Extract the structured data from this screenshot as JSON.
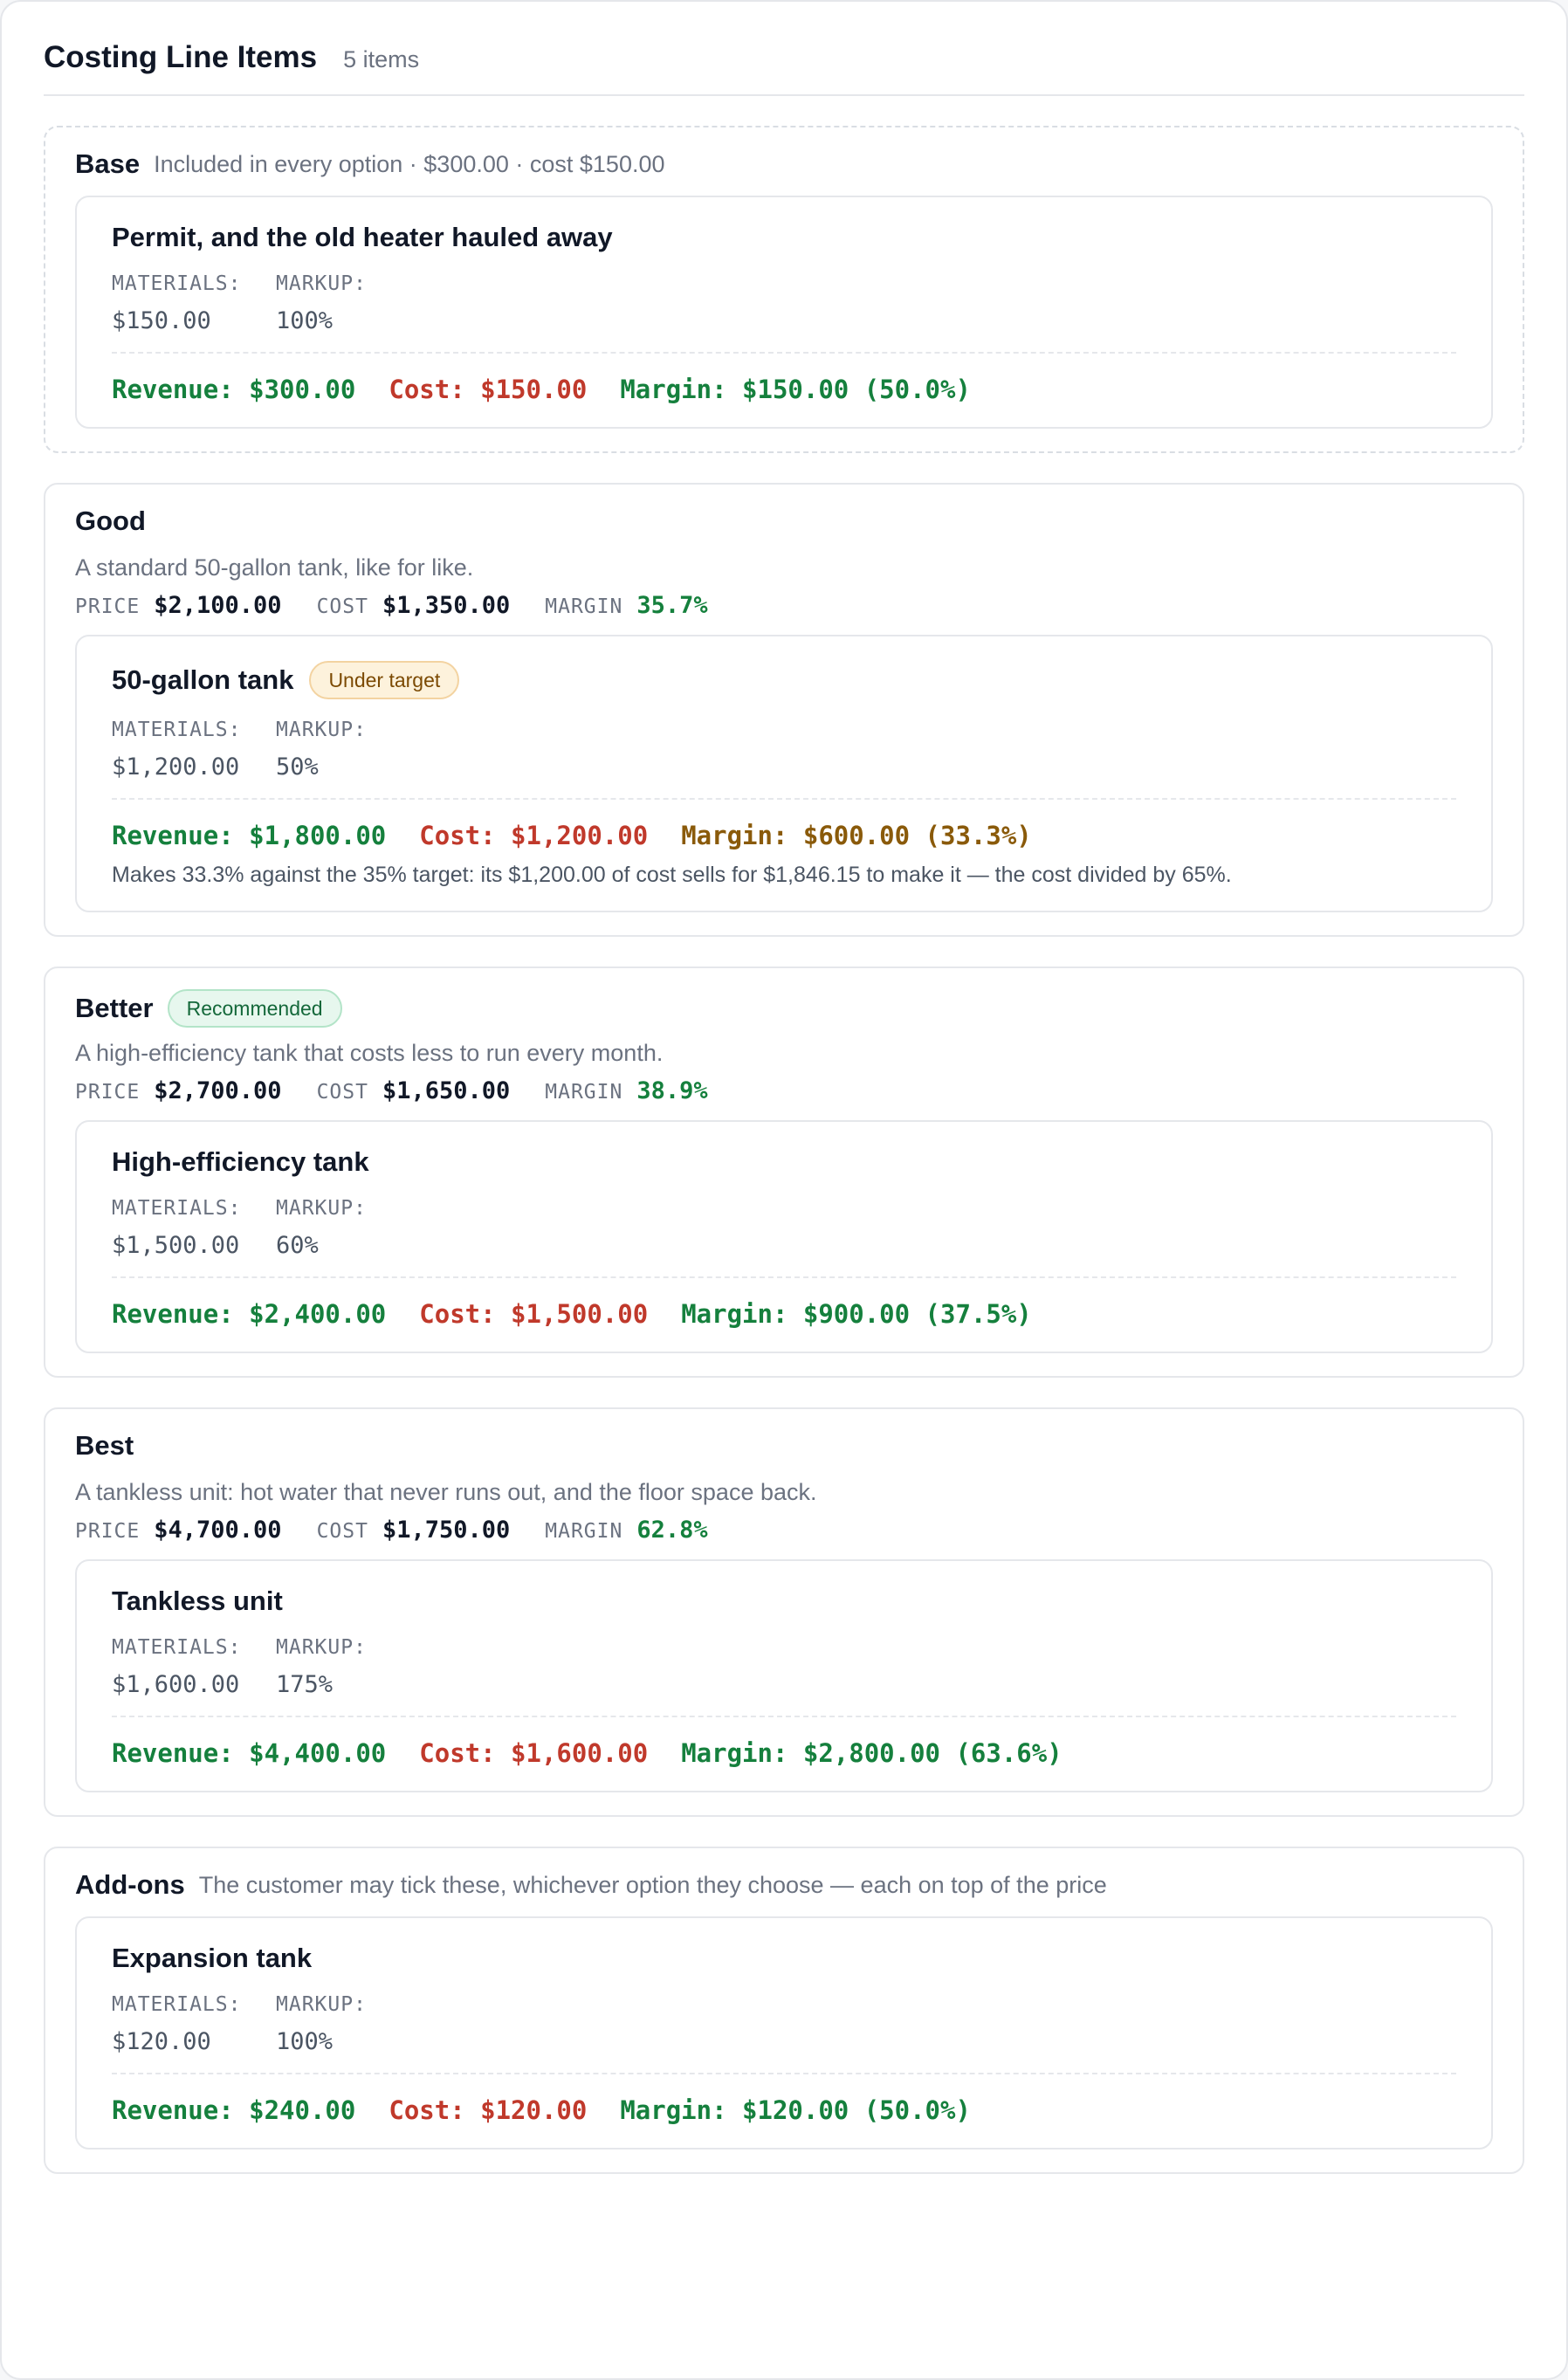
{
  "header": {
    "title": "Costing Line Items",
    "count": "5 items"
  },
  "labels": {
    "price": "PRICE",
    "cost": "COST",
    "margin": "MARGIN",
    "materials": "MATERIALS:",
    "markup": "MARKUP:"
  },
  "groups": [
    {
      "title": "Base",
      "subtitle": "Included in every option · $300.00 · cost $150.00",
      "items": [
        {
          "title": "Permit, and the old heater hauled away",
          "materials": "$150.00",
          "markup": "100%",
          "revenue": "Revenue: $300.00",
          "cost": "Cost: $150.00",
          "margin": "Margin: $150.00 (50.0%)"
        }
      ]
    },
    {
      "title": "Good",
      "description": "A standard 50-gallon tank, like for like.",
      "price": "$2,100.00",
      "cost": "$1,350.00",
      "margin": "35.7%",
      "items": [
        {
          "title": "50-gallon tank",
          "badge": "Under target",
          "materials": "$1,200.00",
          "markup": "50%",
          "revenue": "Revenue: $1,800.00",
          "cost": "Cost: $1,200.00",
          "margin": "Margin: $600.00 (33.3%)",
          "note": "Makes 33.3% against the 35% target: its $1,200.00 of cost sells for $1,846.15 to make it — the cost divided by 65%."
        }
      ]
    },
    {
      "title": "Better",
      "badge": "Recommended",
      "description": "A high-efficiency tank that costs less to run every month.",
      "price": "$2,700.00",
      "cost": "$1,650.00",
      "margin": "38.9%",
      "items": [
        {
          "title": "High-efficiency tank",
          "materials": "$1,500.00",
          "markup": "60%",
          "revenue": "Revenue: $2,400.00",
          "cost": "Cost: $1,500.00",
          "margin": "Margin: $900.00 (37.5%)"
        }
      ]
    },
    {
      "title": "Best",
      "description": "A tankless unit: hot water that never runs out, and the floor space back.",
      "price": "$4,700.00",
      "cost": "$1,750.00",
      "margin": "62.8%",
      "items": [
        {
          "title": "Tankless unit",
          "materials": "$1,600.00",
          "markup": "175%",
          "revenue": "Revenue: $4,400.00",
          "cost": "Cost: $1,600.00",
          "margin": "Margin: $2,800.00 (63.6%)"
        }
      ]
    },
    {
      "title": "Add-ons",
      "subtitle": "The customer may tick these, whichever option they choose — each on top of the price",
      "items": [
        {
          "title": "Expansion tank",
          "materials": "$120.00",
          "markup": "100%",
          "revenue": "Revenue: $240.00",
          "cost": "Cost: $120.00",
          "margin": "Margin: $120.00 (50.0%)"
        }
      ]
    }
  ]
}
